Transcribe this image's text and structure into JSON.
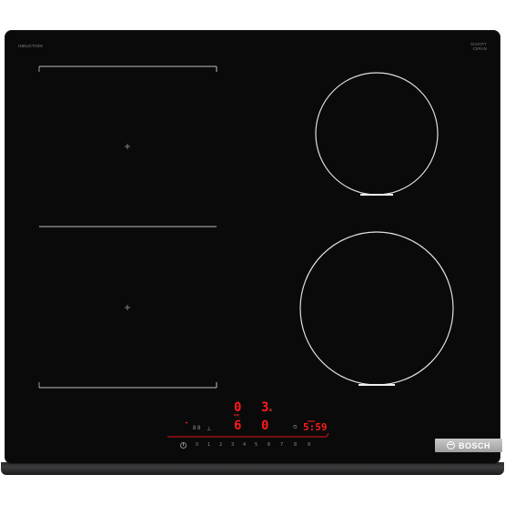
{
  "hob": {
    "brand_top_left": "INDUCTION",
    "brand_top_left_sub": "",
    "brand_top_right_line1": "SCHOTT",
    "brand_top_right_line2": "CERAN",
    "brand_top_right_sub": "",
    "logo_text": "BOSCH"
  },
  "display": {
    "top_left_digit": "0",
    "top_right_digit": "3",
    "top_right_sub": "a",
    "middle_left_digit": "6",
    "middle_right_digit": "0",
    "timer": "5:59",
    "indicator_left": "8 8",
    "indicator_timer_icon": "⏲"
  },
  "power_scale": [
    "0",
    "1",
    "2",
    "3",
    "4",
    "5",
    "6",
    "7",
    "8",
    "9"
  ],
  "colors": {
    "glass": "#0a0a0b",
    "display_red": "#ff1a1a",
    "zone_outline": "#d8d8d8"
  },
  "icons": [
    "power-icon",
    "timer-icon",
    "bosch-logo-icon"
  ]
}
